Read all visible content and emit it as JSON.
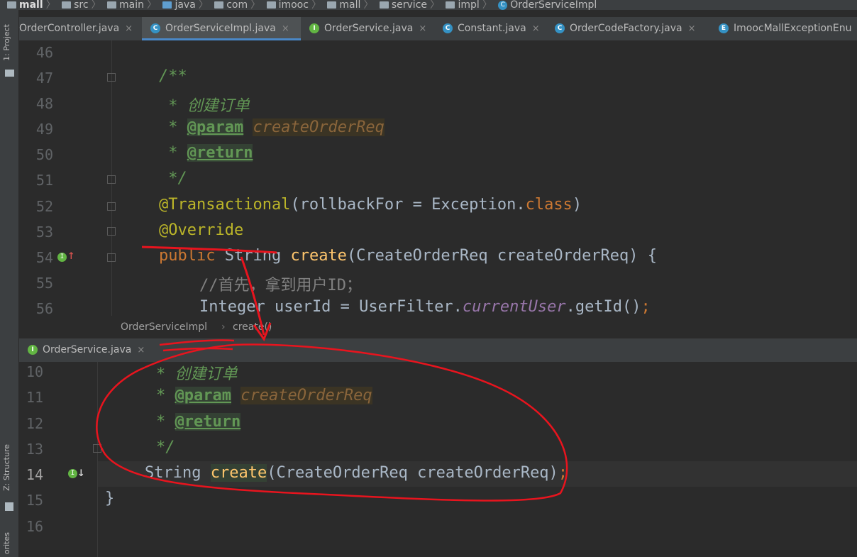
{
  "breadcrumbs": [
    "mall",
    "src",
    "main",
    "java",
    "com",
    "imooc",
    "mall",
    "service",
    "impl",
    "OrderServiceImpl"
  ],
  "tool_strip": {
    "project_label": "1: Project",
    "structure_label": "Z: Structure",
    "favorites_label": "orites"
  },
  "tabs": [
    {
      "label": "OrderController.java",
      "icon": "C",
      "close": "×"
    },
    {
      "label": "OrderServiceImpl.java",
      "icon": "C",
      "close": "×",
      "active": true
    },
    {
      "label": "OrderService.java",
      "icon": "I",
      "close": "×"
    },
    {
      "label": "Constant.java",
      "icon": "C",
      "close": "×"
    },
    {
      "label": "OrderCodeFactory.java",
      "icon": "C",
      "close": "×"
    },
    {
      "label": "ImoocMallExceptionEnu",
      "icon": "E"
    }
  ],
  "editor": {
    "line_numbers": [
      "46",
      "47",
      "48",
      "49",
      "50",
      "51",
      "52",
      "53",
      "54",
      "55",
      "56"
    ],
    "javadoc_open": "/**",
    "javadoc_desc": " * 创建订单",
    "star": " * ",
    "param_tag": "@param",
    "param_name": "createOrderReq",
    "return_tag": "@return",
    "javadoc_close": " */",
    "ann_transactional": "@Transactional",
    "rollback_pre": "(rollbackFor = Exception.",
    "class_kw": "class",
    "rollback_post": ")",
    "ann_override": "@Override",
    "kw_public": "public",
    "type_string": " String ",
    "method_name": "create",
    "params": "(CreateOrderReq createOrderReq) {",
    "comment_line": "//首先，拿到用户ID；",
    "line56_pre": "Integer userId = UserFilter.",
    "line56_field": "currentUser",
    "line56_post": ".getId()",
    "line56_semi": ";"
  },
  "nav_breadcrumb": {
    "class_name": "OrderServiceImpl",
    "separator": "›",
    "method": "create()"
  },
  "peek": {
    "tab_label": "OrderService.java",
    "tab_close": "×",
    "line_numbers": [
      "10",
      "11",
      "12",
      "13",
      "14",
      "15",
      "16"
    ],
    "javadoc_desc": "* 创建订单",
    "star": "* ",
    "param_tag": "@param",
    "param_name": "createOrderReq",
    "return_tag": "@return",
    "javadoc_close": "*/",
    "sig_type": "String ",
    "sig_method": "create",
    "sig_params": "(CreateOrderReq createOrderReq)",
    "sig_semi": ";",
    "closing_brace": "}"
  },
  "colors": {
    "accent": "#4a88c7",
    "annotation_ink": "#e8141e"
  }
}
